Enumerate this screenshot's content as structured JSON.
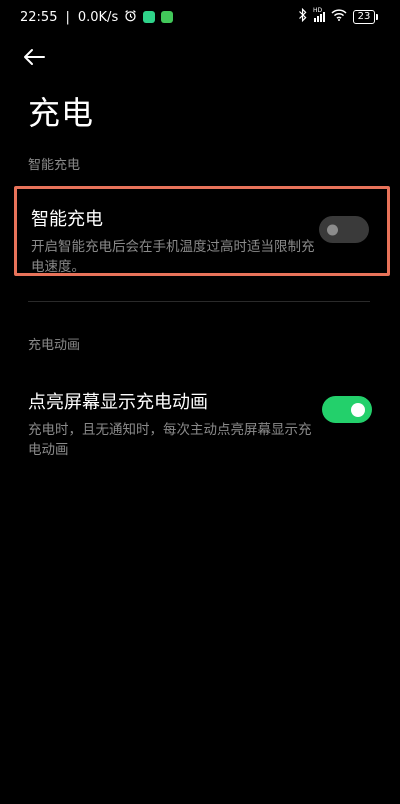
{
  "status_bar": {
    "time": "22:55",
    "separator": "|",
    "net_speed": "0.0K/s",
    "network_label": "HD",
    "battery_level": "23",
    "app_icon_colors": [
      "#2fd38a",
      "#42c85a"
    ]
  },
  "header": {
    "title": "充电"
  },
  "sections": [
    {
      "header": "智能充电",
      "setting": {
        "title": "智能充电",
        "description": "开启智能充电后会在手机温度过高时适当限制充电速度。",
        "enabled": false
      }
    },
    {
      "header": "充电动画",
      "setting": {
        "title": "点亮屏幕显示充电动画",
        "description": "充电时，且无通知时，每次主动点亮屏幕显示充电动画",
        "enabled": true
      }
    }
  ],
  "colors": {
    "background": "#000000",
    "highlight_border": "#e8735a",
    "toggle_on": "#23d06b",
    "toggle_off": "#3a3a3a",
    "secondary_text": "#8a8a8a"
  }
}
